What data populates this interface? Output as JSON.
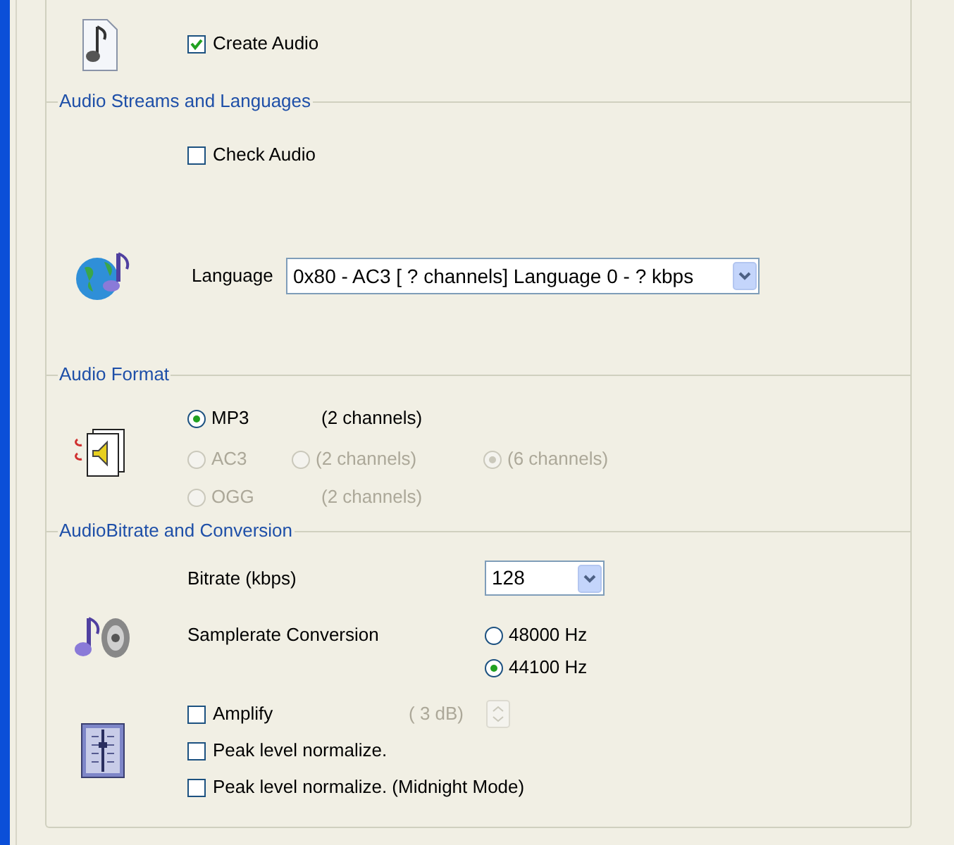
{
  "general": {
    "create_audio": {
      "label": "Create Audio",
      "checked": true
    }
  },
  "streams": {
    "title": "Audio Streams and Languages",
    "check_audio": {
      "label": "Check Audio",
      "checked": false
    },
    "language": {
      "label": "Language",
      "value": "0x80 - AC3 [ ? channels] Language 0 - ? kbps"
    }
  },
  "format": {
    "title": "Audio Format",
    "rows": [
      {
        "radio": {
          "label": "MP3",
          "selected": true,
          "disabled": false
        },
        "channels": [
          {
            "kind": "text",
            "label": "(2 channels)",
            "disabled": false
          }
        ]
      },
      {
        "radio": {
          "label": "AC3",
          "selected": false,
          "disabled": true
        },
        "channels": [
          {
            "kind": "radio",
            "label": "(2 channels)",
            "selected": false,
            "disabled": true
          },
          {
            "kind": "radio",
            "label": "(6 channels)",
            "selected": true,
            "disabled": true
          }
        ]
      },
      {
        "radio": {
          "label": "OGG",
          "selected": false,
          "disabled": true
        },
        "channels": [
          {
            "kind": "text",
            "label": "(2 channels)",
            "disabled": true
          }
        ]
      }
    ]
  },
  "bitrate": {
    "title": "AudioBitrate and Conversion",
    "bitrate": {
      "label": "Bitrate (kbps)",
      "value": "128"
    },
    "samplerate": {
      "label": "Samplerate Conversion",
      "options": [
        {
          "label": "48000 Hz",
          "selected": false
        },
        {
          "label": "44100 Hz",
          "selected": true
        }
      ]
    },
    "checks": [
      {
        "label": "Amplify",
        "checked": false,
        "extra": "( 3 dB)"
      },
      {
        "label": "Peak level normalize.",
        "checked": false
      },
      {
        "label": "Peak level normalize. (Midnight Mode)",
        "checked": false
      }
    ]
  }
}
